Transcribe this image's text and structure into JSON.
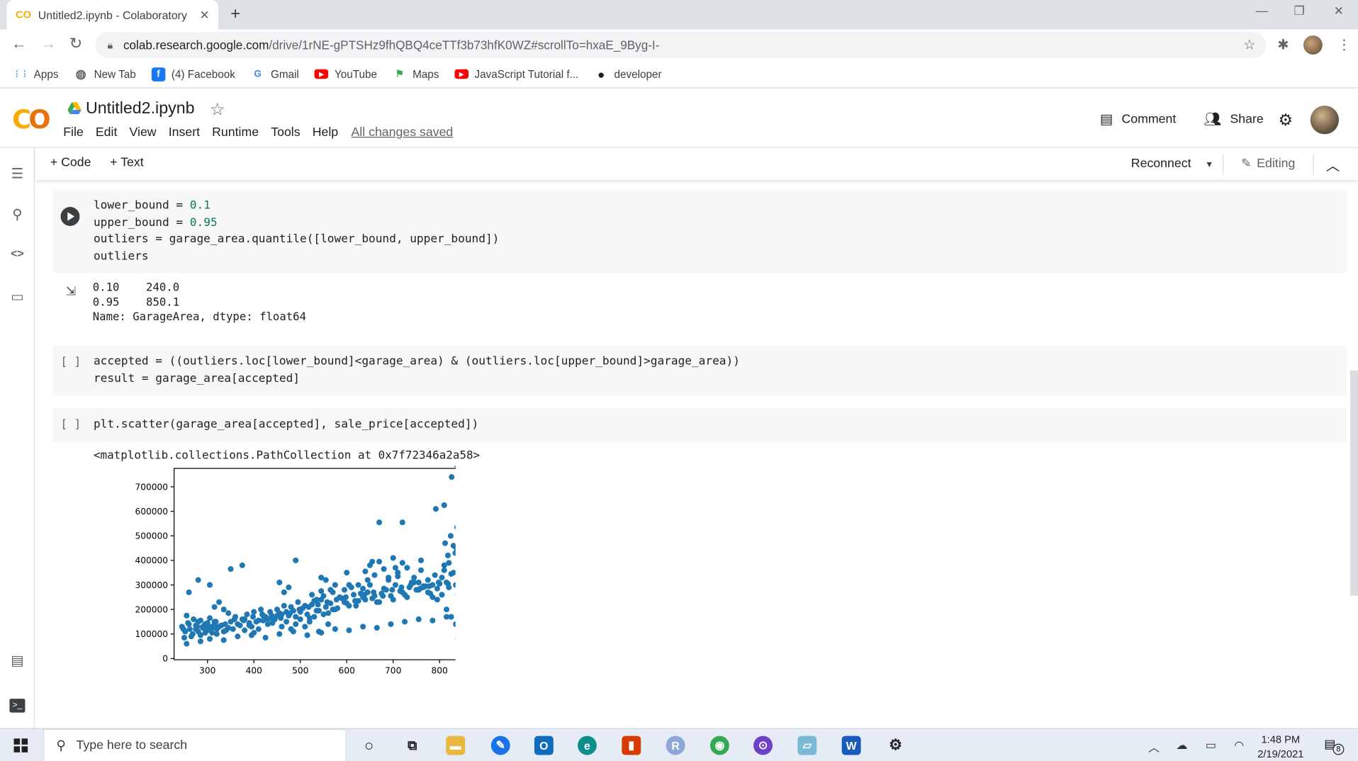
{
  "browser": {
    "tab_title": "Untitled2.ipynb - Colaboratory",
    "tab_favicon": "CO",
    "url_host": "colab.research.google.com",
    "url_path": "/drive/1rNE-gPTSHz9fhQBQ4ceTTf3b73hfK0WZ#scrollTo=hxaE_9Byg-I-"
  },
  "bookmarks": [
    {
      "label": "Apps",
      "icon": "apps-grid-icon",
      "color": "#4285f4"
    },
    {
      "label": "New Tab",
      "icon": "globe-icon",
      "color": "#5f6368"
    },
    {
      "label": "(4) Facebook",
      "icon": "facebook-icon",
      "color": "#1877f2"
    },
    {
      "label": "Gmail",
      "icon": "google-icon",
      "color": "#4285f4"
    },
    {
      "label": "YouTube",
      "icon": "youtube-icon",
      "color": "#ff0000"
    },
    {
      "label": "Maps",
      "icon": "maps-icon",
      "color": "#34a853"
    },
    {
      "label": "JavaScript Tutorial f...",
      "icon": "youtube-icon",
      "color": "#ff0000"
    },
    {
      "label": "developer",
      "icon": "github-icon",
      "color": "#202124"
    }
  ],
  "colab": {
    "notebook_title": "Untitled2.ipynb",
    "menu": [
      "File",
      "Edit",
      "View",
      "Insert",
      "Runtime",
      "Tools",
      "Help"
    ],
    "save_status": "All changes saved",
    "comment_label": "Comment",
    "share_label": "Share",
    "toolbar": {
      "code_label": "+ Code",
      "text_label": "+ Text",
      "reconnect_label": "Reconnect",
      "editing_label": "Editing"
    }
  },
  "cells": {
    "cell1": {
      "lines": [
        [
          "lower_bound = ",
          "0.1"
        ],
        [
          "upper_bound = ",
          "0.95"
        ],
        [
          "outliers = garage_area.quantile([lower_bound, upper_bound])",
          ""
        ],
        [
          "outliers",
          ""
        ]
      ],
      "output": [
        "0.10    240.0",
        "0.95    850.1",
        "Name: GarageArea, dtype: float64"
      ]
    },
    "cell2": {
      "bracket": "[ ]",
      "line1": "accepted = ((outliers.loc[lower_bound]<garage_area) & (outliers.loc[upper_bound]>garage_area))",
      "line2": "result = garage_area[accepted]"
    },
    "cell3": {
      "bracket": "[ ]",
      "line1": "plt.scatter(garage_area[accepted], sale_price[accepted])",
      "output_text": "<matplotlib.collections.PathCollection at 0x7f72346a2a58>"
    }
  },
  "chart_data": {
    "type": "scatter",
    "title": "",
    "xlabel": "",
    "ylabel": "",
    "xlim": [
      228,
      868
    ],
    "ylim": [
      -5000,
      775000
    ],
    "xticks": [
      "300",
      "400",
      "500",
      "600",
      "700",
      "800"
    ],
    "xtick_values": [
      300,
      400,
      500,
      600,
      700,
      800
    ],
    "yticks": [
      "0",
      "100000",
      "200000",
      "300000",
      "400000",
      "500000",
      "600000",
      "700000"
    ],
    "ytick_values": [
      0,
      100000,
      200000,
      300000,
      400000,
      500000,
      600000,
      700000
    ],
    "color": "#1f77b4",
    "grid": false,
    "x": [
      245,
      252,
      258,
      262,
      268,
      275,
      280,
      285,
      290,
      295,
      300,
      305,
      310,
      315,
      320,
      250,
      260,
      270,
      280,
      290,
      300,
      310,
      320,
      330,
      340,
      255,
      265,
      275,
      285,
      295,
      305,
      315,
      325,
      335,
      345,
      350,
      360,
      370,
      380,
      390,
      400,
      410,
      420,
      430,
      440,
      450,
      460,
      470,
      480,
      490,
      500,
      355,
      365,
      375,
      385,
      395,
      405,
      415,
      425,
      435,
      445,
      455,
      465,
      475,
      485,
      495,
      505,
      515,
      525,
      535,
      545,
      555,
      565,
      575,
      585,
      595,
      605,
      615,
      625,
      635,
      645,
      655,
      665,
      675,
      685,
      695,
      705,
      715,
      725,
      735,
      745,
      755,
      765,
      775,
      785,
      795,
      805,
      815,
      825,
      835,
      845,
      510,
      520,
      530,
      540,
      550,
      560,
      570,
      580,
      590,
      600,
      610,
      620,
      630,
      640,
      650,
      660,
      670,
      680,
      690,
      700,
      710,
      720,
      730,
      740,
      750,
      760,
      770,
      780,
      790,
      800,
      810,
      820,
      830,
      840,
      480,
      490,
      500,
      510,
      520,
      530,
      540,
      550,
      560,
      570,
      430,
      440,
      450,
      460,
      470,
      420,
      410,
      400,
      390,
      380,
      640,
      650,
      660,
      670,
      680,
      690,
      700,
      710,
      720,
      730,
      812,
      824,
      836,
      844,
      818,
      830,
      842,
      820,
      834,
      846,
      670,
      720,
      810,
      792,
      826,
      842,
      838,
      260,
      280,
      350,
      305,
      375,
      490,
      545,
      600,
      655,
      705,
      760,
      810,
      455,
      465,
      475,
      585,
      595,
      605,
      315,
      325,
      335,
      345,
      555,
      565,
      575,
      525,
      535,
      545,
      625,
      635,
      645,
      745,
      755,
      765,
      775,
      785,
      795,
      805,
      815,
      825,
      835,
      845,
      255,
      285,
      305,
      335,
      365,
      395,
      425,
      455,
      485,
      515,
      545,
      575,
      605,
      635,
      665,
      695,
      725,
      755,
      785,
      815,
      840,
      248,
      278,
      298,
      318,
      338,
      358,
      378,
      398,
      418,
      438,
      458,
      478,
      498,
      518,
      538,
      558,
      578,
      598,
      618,
      638,
      658,
      678,
      698,
      718,
      738,
      758,
      778,
      798,
      818,
      838
    ],
    "y": [
      130000,
      110000,
      145000,
      120000,
      100000,
      135000,
      150000,
      95000,
      125000,
      140000,
      115000,
      130000,
      105000,
      150000,
      120000,
      85000,
      140000,
      160000,
      110000,
      130000,
      145000,
      125000,
      100000,
      135000,
      115000,
      175000,
      90000,
      120000,
      155000,
      105000,
      165000,
      140000,
      130000,
      110000,
      125000,
      150000,
      170000,
      135000,
      160000,
      145000,
      190000,
      155000,
      175000,
      140000,
      165000,
      200000,
      180000,
      150000,
      210000,
      170000,
      190000,
      120000,
      140000,
      160000,
      180000,
      130000,
      150000,
      200000,
      170000,
      190000,
      160000,
      185000,
      215000,
      175000,
      195000,
      230000,
      205000,
      180000,
      220000,
      195000,
      240000,
      210000,
      225000,
      200000,
      250000,
      230000,
      215000,
      260000,
      235000,
      250000,
      270000,
      245000,
      230000,
      265000,
      280000,
      255000,
      300000,
      275000,
      260000,
      290000,
      310000,
      280000,
      295000,
      320000,
      300000,
      285000,
      330000,
      310000,
      345000,
      300000,
      320000,
      215000,
      165000,
      235000,
      195000,
      255000,
      185000,
      270000,
      205000,
      245000,
      225000,
      290000,
      215000,
      265000,
      240000,
      300000,
      255000,
      230000,
      285000,
      320000,
      240000,
      335000,
      270000,
      250000,
      310000,
      280000,
      360000,
      295000,
      265000,
      340000,
      305000,
      380000,
      290000,
      350000,
      260000,
      120000,
      140000,
      160000,
      130000,
      150000,
      170000,
      110000,
      180000,
      140000,
      200000,
      160000,
      145000,
      175000,
      130000,
      190000,
      155000,
      120000,
      105000,
      135000,
      115000,
      355000,
      380000,
      340000,
      395000,
      365000,
      330000,
      410000,
      350000,
      390000,
      370000,
      470000,
      500000,
      450000,
      480000,
      420000,
      460000,
      440000,
      390000,
      430000,
      410000,
      555000,
      555000,
      625000,
      610000,
      740000,
      745000,
      535000,
      270000,
      320000,
      365000,
      300000,
      380000,
      400000,
      330000,
      350000,
      395000,
      370000,
      400000,
      360000,
      310000,
      270000,
      290000,
      250000,
      280000,
      300000,
      210000,
      230000,
      200000,
      185000,
      320000,
      280000,
      300000,
      260000,
      240000,
      275000,
      300000,
      285000,
      320000,
      330000,
      310000,
      290000,
      270000,
      250000,
      240000,
      260000,
      200000,
      170000,
      140000,
      45000,
      60000,
      70000,
      80000,
      75000,
      90000,
      95000,
      85000,
      100000,
      110000,
      95000,
      105000,
      120000,
      115000,
      130000,
      125000,
      140000,
      150000,
      160000,
      155000,
      170000,
      80000,
      120000,
      130000,
      125000,
      150000,
      140000,
      160000,
      155000,
      170000,
      180000,
      175000,
      165000,
      185000,
      200000,
      210000,
      220000,
      230000,
      240000,
      250000,
      235000,
      260000,
      270000,
      255000,
      280000,
      290000,
      300000,
      285000,
      295000,
      310000,
      305000
    ]
  },
  "taskbar": {
    "search_placeholder": "Type here to search",
    "time": "1:48 PM",
    "date": "2/19/2021",
    "notification_count": "8"
  }
}
